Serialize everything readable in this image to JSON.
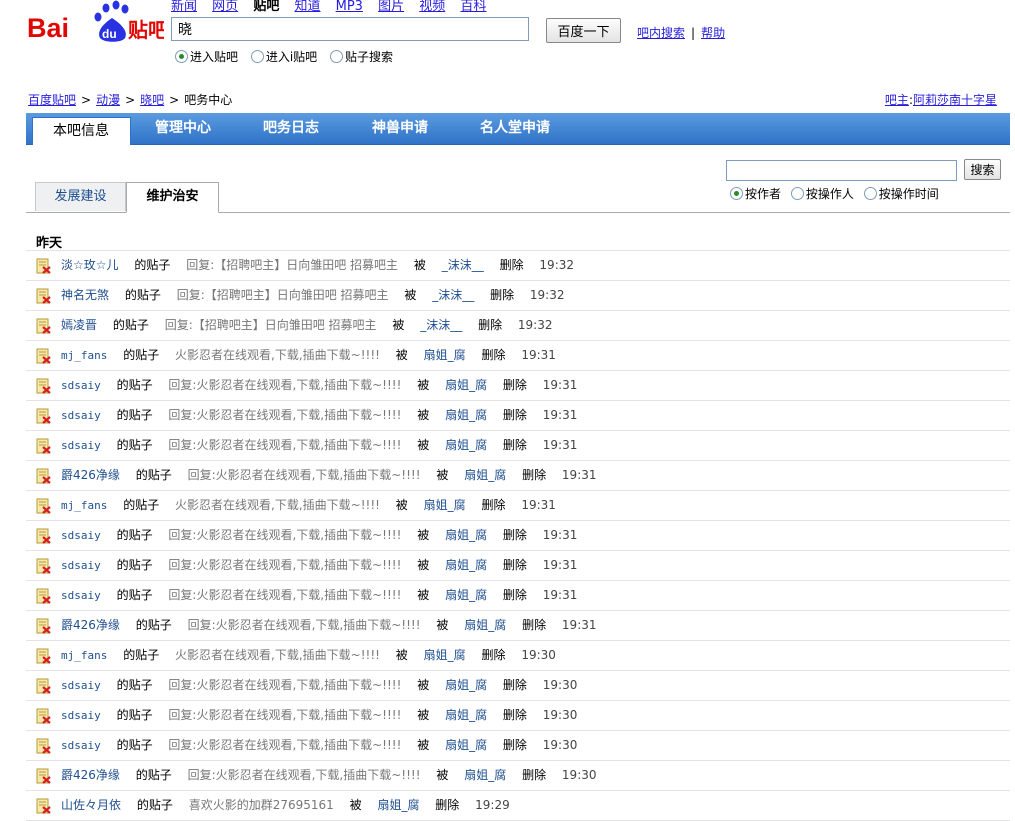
{
  "logo": {
    "text_bai": "Bai",
    "text_du": "du",
    "text_tieba": "贴吧"
  },
  "topnav": [
    "新闻",
    "网页",
    "贴吧",
    "知道",
    "MP3",
    "图片",
    "视频",
    "百科"
  ],
  "search": {
    "value": "晓",
    "button": "百度一下",
    "link_inbar": "吧内搜索",
    "sep": "|",
    "link_help": "帮助"
  },
  "search_scope": [
    "进入贴吧",
    "进入i贴吧",
    "贴子搜索"
  ],
  "breadcrumb": [
    "百度贴吧",
    "动漫",
    "晓吧",
    "吧务中心"
  ],
  "owner": {
    "label": "吧主",
    "colon": ":",
    "name": "阿莉莎南十字星"
  },
  "tabs": [
    "本吧信息",
    "管理中心",
    "吧务日志",
    "神兽申请",
    "名人堂申请"
  ],
  "filter": {
    "button": "搜索",
    "options": [
      "按作者",
      "按操作人",
      "按操作时间"
    ]
  },
  "subtabs": [
    "发展建设",
    "维护治安"
  ],
  "day": "昨天",
  "labels": {
    "post": "的贴子",
    "by": "被",
    "delete": "删除"
  },
  "rows": [
    {
      "author": "淡☆玫☆儿",
      "title": "回复:【招聘吧主】日向雏田吧 招募吧主",
      "operator": "_沫沫__",
      "time": "19:32"
    },
    {
      "author": "神名无煞",
      "title": "回复:【招聘吧主】日向雏田吧 招募吧主",
      "operator": "_沫沫__",
      "time": "19:32"
    },
    {
      "author": "嫣凌晋",
      "title": "回复:【招聘吧主】日向雏田吧 招募吧主",
      "operator": "_沫沫__",
      "time": "19:32"
    },
    {
      "author": "mj_fans",
      "title": "火影忍者在线观看,下载,插曲下载~!!!!",
      "operator": "扇姐_腐",
      "time": "19:31"
    },
    {
      "author": "sdsaiy",
      "title": "回复:火影忍者在线观看,下载,插曲下载~!!!!",
      "operator": "扇姐_腐",
      "time": "19:31"
    },
    {
      "author": "sdsaiy",
      "title": "回复:火影忍者在线观看,下载,插曲下载~!!!!",
      "operator": "扇姐_腐",
      "time": "19:31"
    },
    {
      "author": "sdsaiy",
      "title": "回复:火影忍者在线观看,下载,插曲下载~!!!!",
      "operator": "扇姐_腐",
      "time": "19:31"
    },
    {
      "author": "爵426净缘",
      "title": "回复:火影忍者在线观看,下载,插曲下载~!!!!",
      "operator": "扇姐_腐",
      "time": "19:31"
    },
    {
      "author": "mj_fans",
      "title": "火影忍者在线观看,下载,插曲下载~!!!!",
      "operator": "扇姐_腐",
      "time": "19:31"
    },
    {
      "author": "sdsaiy",
      "title": "回复:火影忍者在线观看,下载,插曲下载~!!!!",
      "operator": "扇姐_腐",
      "time": "19:31"
    },
    {
      "author": "sdsaiy",
      "title": "回复:火影忍者在线观看,下载,插曲下载~!!!!",
      "operator": "扇姐_腐",
      "time": "19:31"
    },
    {
      "author": "sdsaiy",
      "title": "回复:火影忍者在线观看,下载,插曲下载~!!!!",
      "operator": "扇姐_腐",
      "time": "19:31"
    },
    {
      "author": "爵426净缘",
      "title": "回复:火影忍者在线观看,下载,插曲下载~!!!!",
      "operator": "扇姐_腐",
      "time": "19:31"
    },
    {
      "author": "mj_fans",
      "title": "火影忍者在线观看,下载,插曲下载~!!!!",
      "operator": "扇姐_腐",
      "time": "19:30"
    },
    {
      "author": "sdsaiy",
      "title": "回复:火影忍者在线观看,下载,插曲下载~!!!!",
      "operator": "扇姐_腐",
      "time": "19:30"
    },
    {
      "author": "sdsaiy",
      "title": "回复:火影忍者在线观看,下载,插曲下载~!!!!",
      "operator": "扇姐_腐",
      "time": "19:30"
    },
    {
      "author": "sdsaiy",
      "title": "回复:火影忍者在线观看,下载,插曲下载~!!!!",
      "operator": "扇姐_腐",
      "time": "19:30"
    },
    {
      "author": "爵426净缘",
      "title": "回复:火影忍者在线观看,下载,插曲下载~!!!!",
      "operator": "扇姐_腐",
      "time": "19:30"
    },
    {
      "author": "山佐々月依",
      "title": "喜欢火影的加群27695161",
      "operator": "扇姐_腐",
      "time": "19:29"
    }
  ],
  "colors": {
    "nav_blue": "#2f73c8",
    "link": "#261cdc",
    "user": "#1f4f8f",
    "logo_red": "#e10602",
    "logo_blue": "#2932e1"
  }
}
